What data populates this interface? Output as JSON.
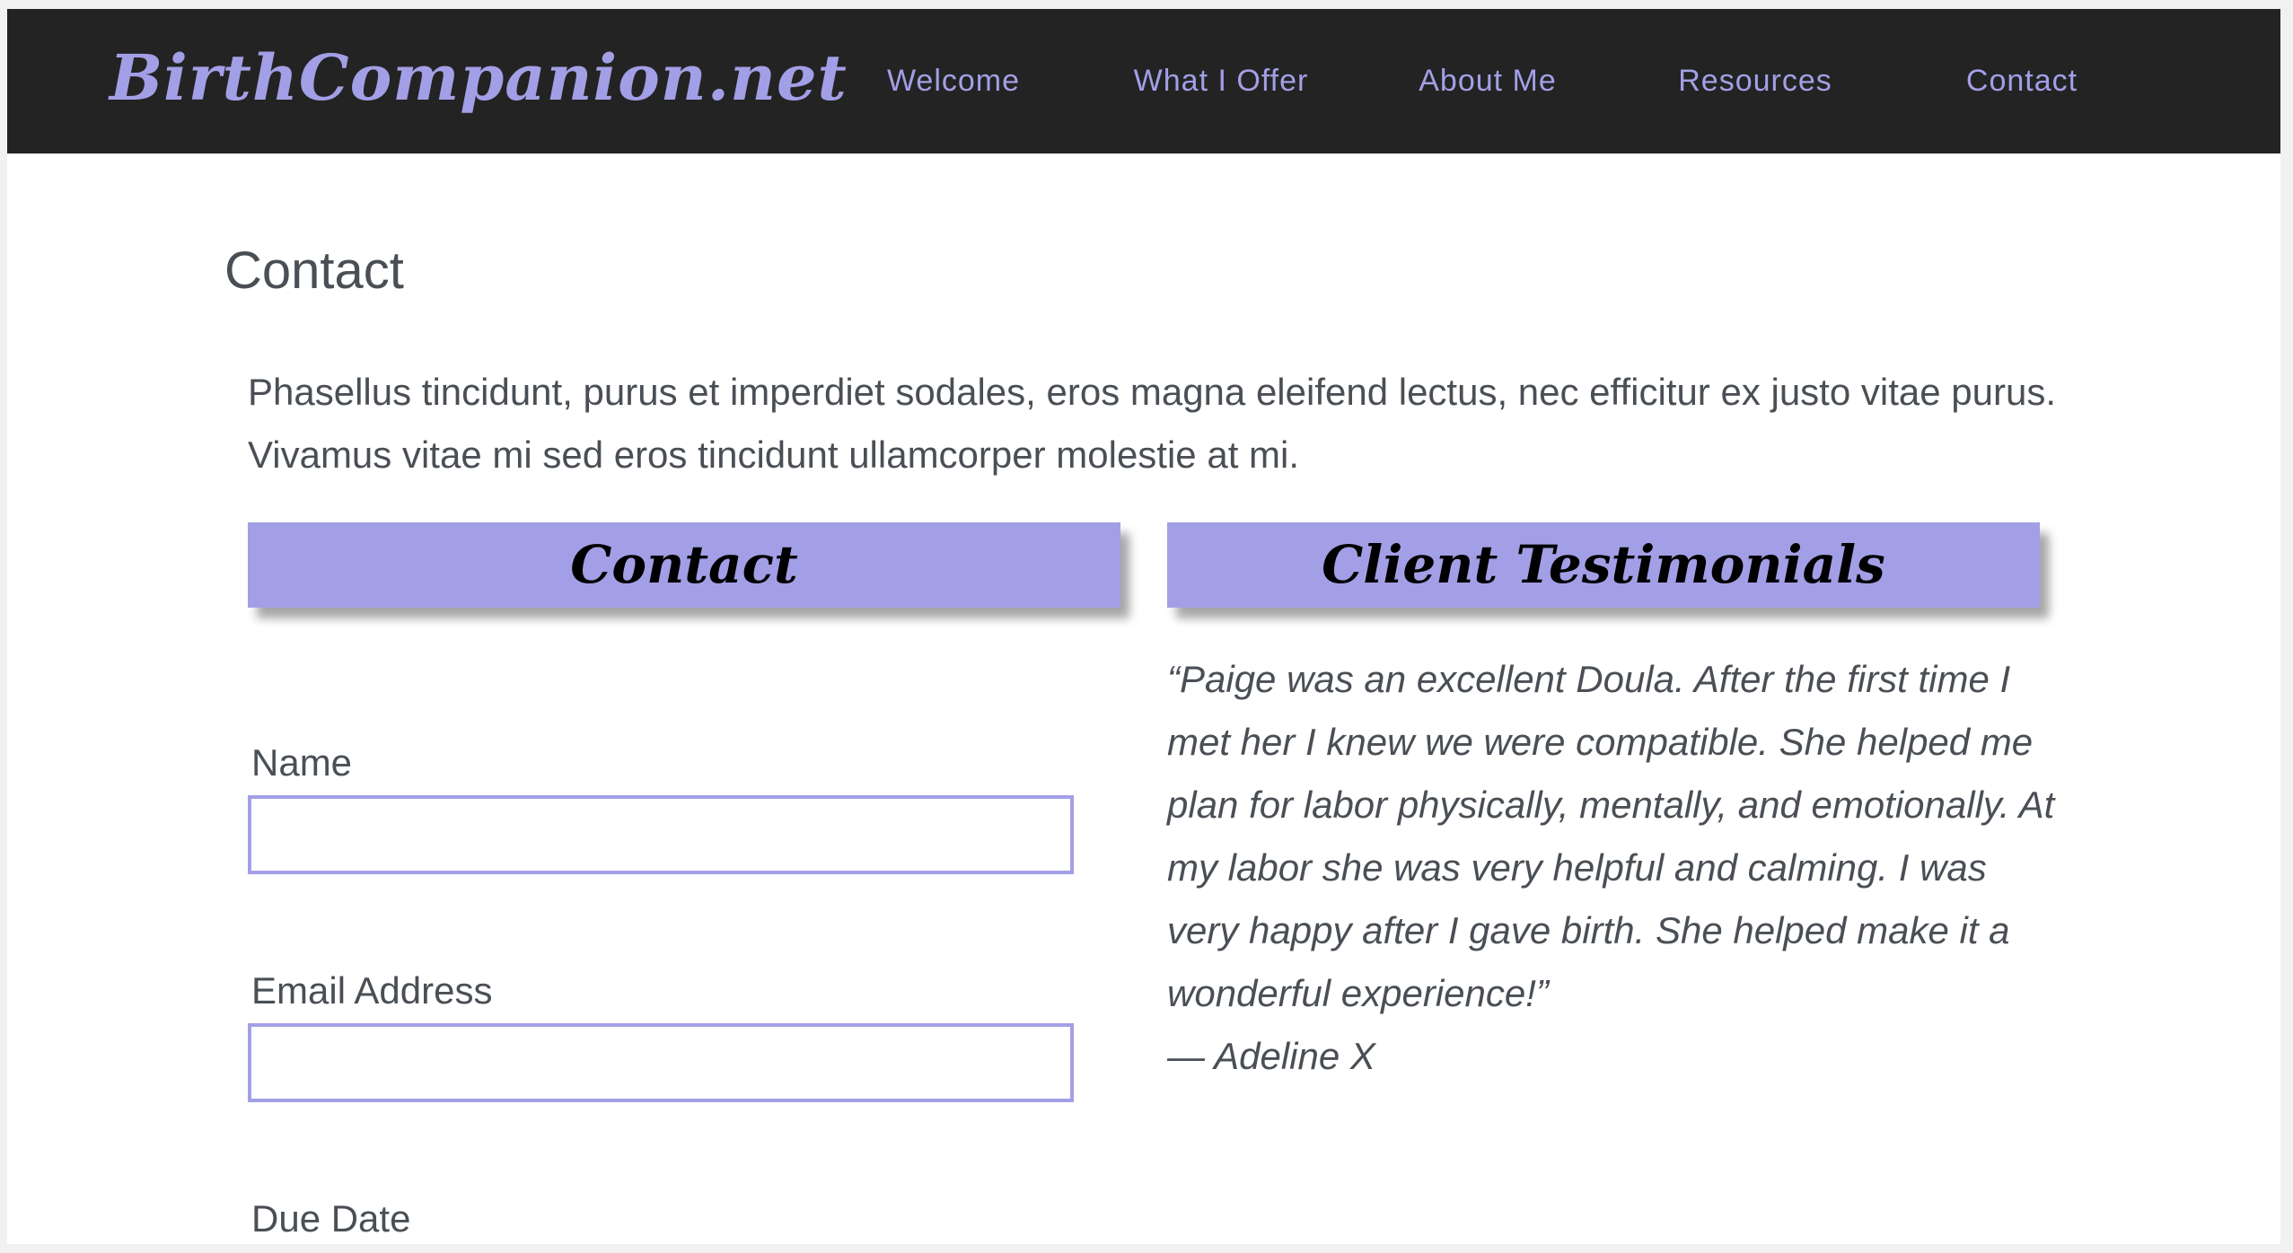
{
  "site": {
    "brand": "BirthCompanion.net"
  },
  "nav": {
    "items": [
      {
        "label": "Welcome"
      },
      {
        "label": "What I Offer"
      },
      {
        "label": "About Me"
      },
      {
        "label": "Resources"
      },
      {
        "label": "Contact"
      }
    ]
  },
  "page": {
    "title": "Contact",
    "intro": "Phasellus tincidunt, purus et imperdiet sodales, eros magna eleifend lectus, nec efficitur ex justo vitae purus. Vivamus vitae mi sed eros tincidunt ullamcorper molestie at mi."
  },
  "contact_form": {
    "header": "Contact",
    "fields": {
      "name_label": "Name",
      "name_value": "",
      "email_label": "Email Address",
      "email_value": "",
      "due_date_label": "Due Date"
    }
  },
  "testimonials": {
    "header": "Client Testimonials",
    "quote": "“Paige was an excellent Doula. After the first time I met her I knew we were compatible. She helped me plan for labor physically, mentally, and emotionally. At my labor she was very helpful and calming. I was very happy after I gave birth. She helped make it a wonderful experience!”",
    "author": "— Adeline X"
  },
  "colors": {
    "accent": "#a39fe6",
    "navbar_bg": "#232323",
    "text": "#4a4f55"
  }
}
